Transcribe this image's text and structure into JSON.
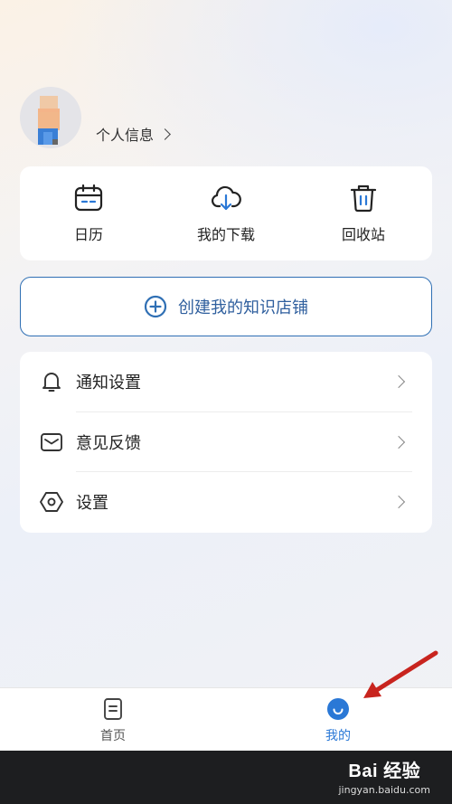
{
  "profile": {
    "link_label": "个人信息"
  },
  "shortcuts": [
    {
      "label": "日历",
      "icon": "calendar-icon"
    },
    {
      "label": "我的下载",
      "icon": "cloud-download-icon"
    },
    {
      "label": "回收站",
      "icon": "trash-icon"
    }
  ],
  "create_store": {
    "label": "创建我的知识店铺",
    "icon": "plus-circle-icon"
  },
  "menu": [
    {
      "label": "通知设置",
      "icon": "bell-icon"
    },
    {
      "label": "意见反馈",
      "icon": "mail-icon"
    },
    {
      "label": "设置",
      "icon": "settings-hex-icon"
    }
  ],
  "tabbar": {
    "home_label": "首页",
    "mine_label": "我的",
    "active": "mine"
  },
  "watermark": {
    "brand": "Bai 经验",
    "url": "jingyan.baidu.com"
  },
  "colors": {
    "accent": "#2a78d6",
    "button_border": "#2f6fb4",
    "annotation_arrow": "#c8241e"
  }
}
